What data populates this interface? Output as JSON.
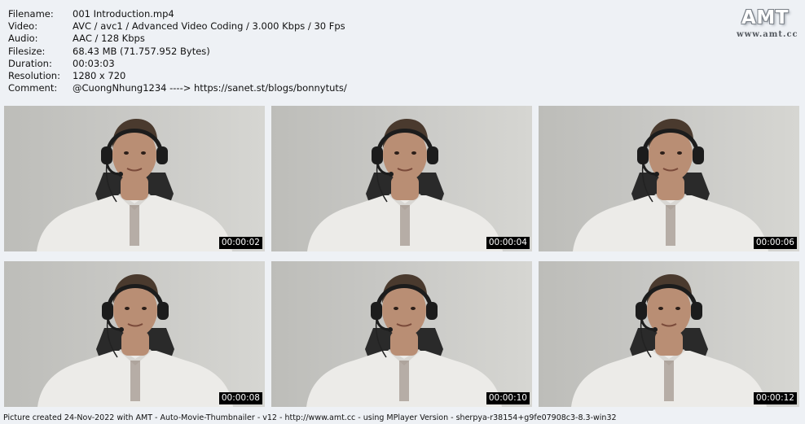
{
  "info": {
    "rows": [
      {
        "label": "Filename:",
        "value": "001 Introduction.mp4"
      },
      {
        "label": "Video:",
        "value": "AVC / avc1 / Advanced Video Coding / 3.000 Kbps / 30 Fps"
      },
      {
        "label": "Audio:",
        "value": "AAC / 128 Kbps"
      },
      {
        "label": "Filesize:",
        "value": "68.43 MB (71.757.952 Bytes)"
      },
      {
        "label": "Duration:",
        "value": "00:03:03"
      },
      {
        "label": "Resolution:",
        "value": "1280 x 720"
      },
      {
        "label": "Comment:",
        "value": "@CuongNhung1234 ----> https://sanet.st/blogs/bonnytuts/"
      }
    ]
  },
  "logo": {
    "mark": "AMT",
    "url": "www.amt.cc"
  },
  "thumbnails": [
    {
      "timecode": "00:00:02"
    },
    {
      "timecode": "00:00:04"
    },
    {
      "timecode": "00:00:06"
    },
    {
      "timecode": "00:00:08"
    },
    {
      "timecode": "00:00:10"
    },
    {
      "timecode": "00:00:12"
    }
  ],
  "footer": {
    "text": "Picture created 24-Nov-2022 with AMT - Auto-Movie-Thumbnailer - v12 - http://www.amt.cc - using MPlayer Version - sherpya-r38154+g9fe07908c3-8.3-win32"
  },
  "colors": {
    "page_background": "#eef1f5",
    "wall": "#c9c9c6",
    "shirt": "#ecebe8",
    "skin": "#b98e74",
    "hair": "#4a3a2e",
    "headset": "#1c1c1c",
    "timecode_bg": "#000000",
    "timecode_text": "#ffffff"
  }
}
